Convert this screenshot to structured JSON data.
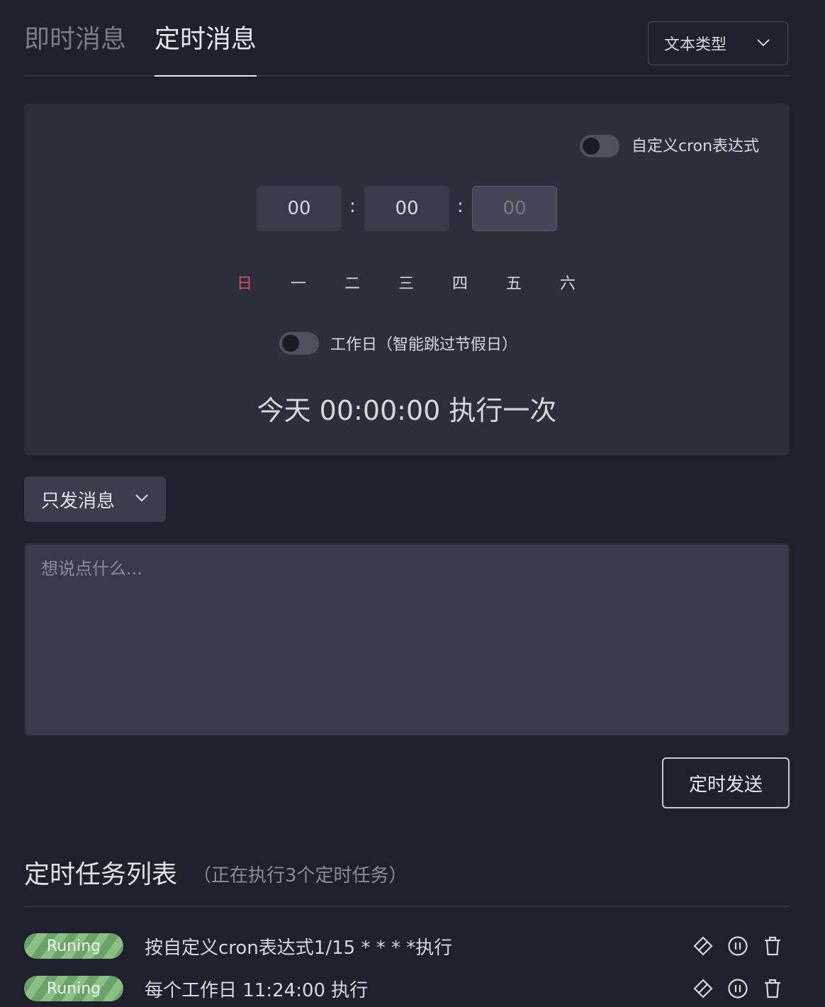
{
  "tabs": {
    "instant": "即时消息",
    "scheduled": "定时消息"
  },
  "type_select": {
    "value": "文本类型"
  },
  "schedule": {
    "cron_toggle_label": "自定义cron表达式",
    "time": {
      "hour": "00",
      "minute": "00",
      "second_placeholder": "00"
    },
    "days": [
      "日",
      "一",
      "二",
      "三",
      "四",
      "五",
      "六"
    ],
    "workday_toggle_label": "工作日（智能跳过节假日）",
    "summary": "今天 00:00:00 执行一次"
  },
  "mode_select": {
    "value": "只发消息"
  },
  "message": {
    "placeholder": "想说点什么..."
  },
  "send_button": "定时发送",
  "task_list": {
    "title": "定时任务列表",
    "subtitle": "（正在执行3个定时任务）",
    "tasks": [
      {
        "status": "Runing",
        "description": "按自定义cron表达式1/15 * * * *执行"
      },
      {
        "status": "Runing",
        "description": "每个工作日 11:24:00 执行"
      }
    ]
  },
  "colors": {
    "background": "#1f202c",
    "panel": "#2c2e3a",
    "sunday": "#d94f5c",
    "badge": "#7bb175"
  }
}
